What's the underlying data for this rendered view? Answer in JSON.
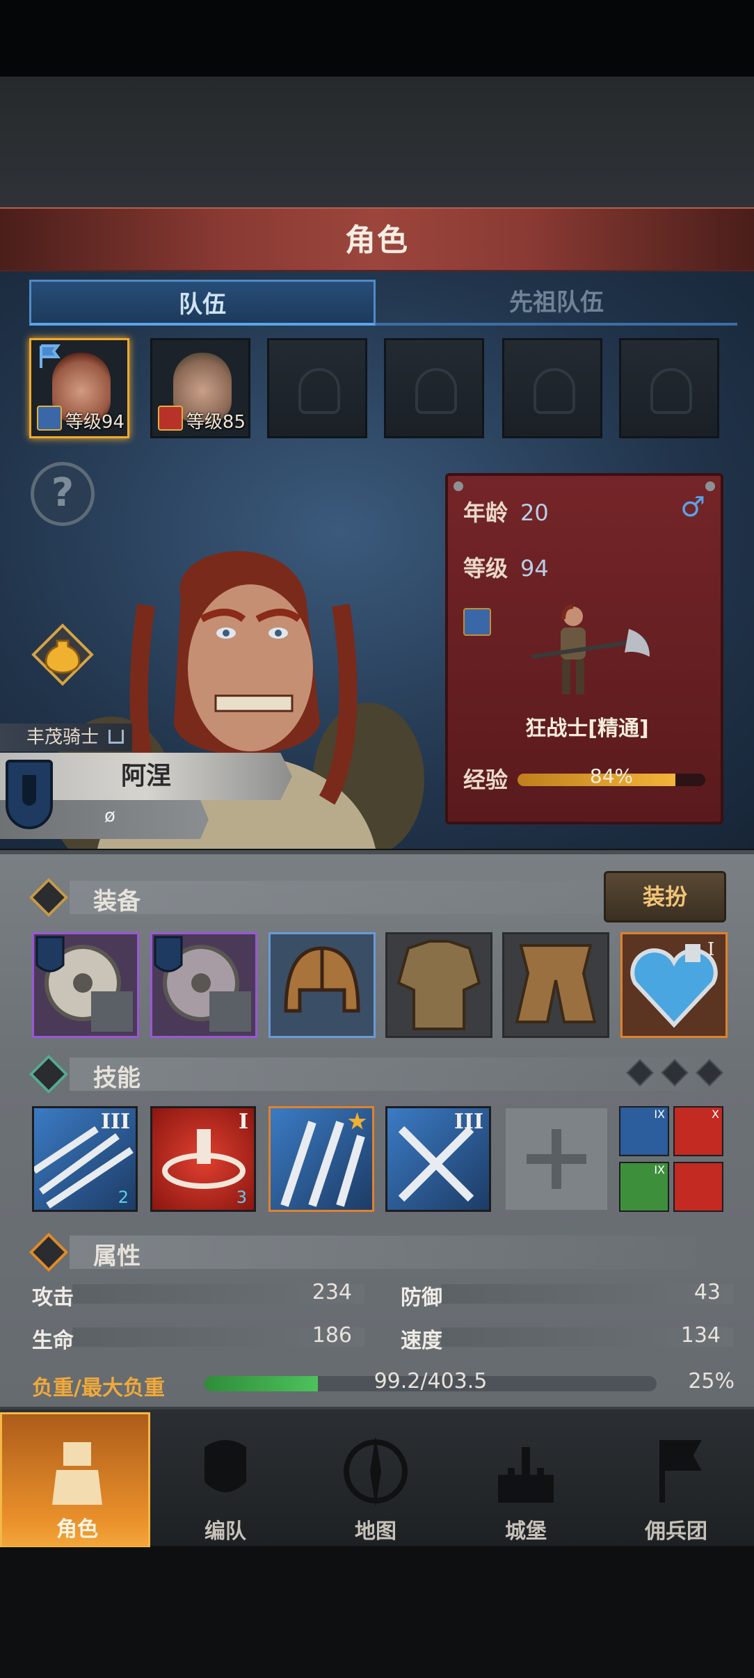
{
  "header": {
    "title": "角色"
  },
  "tabs": [
    {
      "label": "队伍",
      "active": true
    },
    {
      "label": "先祖队伍",
      "active": false
    }
  ],
  "team_slots": [
    {
      "level_label": "等级94",
      "filled": true,
      "selected": true
    },
    {
      "level_label": "等级85",
      "filled": true,
      "selected": false
    },
    {
      "filled": false
    },
    {
      "filled": false
    },
    {
      "filled": false
    },
    {
      "filled": false
    }
  ],
  "hero": {
    "faction": "丰茂骑士",
    "name": "阿涅",
    "subtitle": "ø",
    "age_label": "年龄",
    "age": "20",
    "level_label": "等级",
    "level": "94",
    "gender_symbol": "♂",
    "class_name": "狂战士[精通]",
    "exp_label": "经验",
    "exp_text": "84%",
    "exp_fraction": 0.84
  },
  "equipment": {
    "title": "装备",
    "dress_button": "装扮",
    "slots": [
      {
        "type": "shield-axe",
        "rarity": "purple"
      },
      {
        "type": "shield-axe",
        "rarity": "purple"
      },
      {
        "type": "helmet",
        "rarity": "blue"
      },
      {
        "type": "armor",
        "rarity": "gray"
      },
      {
        "type": "boots",
        "rarity": "gray"
      },
      {
        "type": "heart-amulet",
        "rarity": "orange",
        "tier": "I"
      }
    ]
  },
  "skills": {
    "title": "技能",
    "slots": [
      {
        "tier": "III",
        "badge": "2",
        "color": "#2c5d9c"
      },
      {
        "tier": "I",
        "badge": "3",
        "color": "#c22a22"
      },
      {
        "tier": "★",
        "color": "#2c5d9c"
      },
      {
        "tier": "III",
        "color": "#2c5d9c"
      },
      {
        "empty": true
      }
    ],
    "passives": [
      {
        "tier": "IX",
        "color": "#2c5d9c"
      },
      {
        "tier": "X",
        "color": "#c22a22"
      },
      {
        "tier": "IX",
        "color": "#3e8f3c"
      },
      {
        "tier": "",
        "color": "#c22a22"
      }
    ]
  },
  "attributes": {
    "title": "属性",
    "attack_label": "攻击",
    "attack": "234",
    "defense_label": "防御",
    "defense": "43",
    "hp_label": "生命",
    "hp": "186",
    "speed_label": "速度",
    "speed": "134",
    "load_label": "负重/最大负重",
    "load": "99.2/403.5",
    "load_pct": "25%",
    "load_fraction": 0.25
  },
  "nav": [
    {
      "label": "角色",
      "active": true
    },
    {
      "label": "编队"
    },
    {
      "label": "地图"
    },
    {
      "label": "城堡"
    },
    {
      "label": "佣兵团"
    }
  ],
  "colors": {
    "accent_orange": "#f2a92a",
    "title_red": "#8a3a33",
    "panel_blue": "#21344b"
  }
}
